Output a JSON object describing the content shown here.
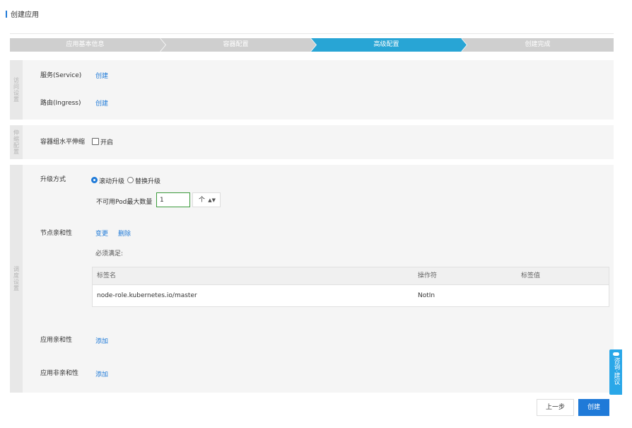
{
  "page": {
    "title": "创建应用"
  },
  "steps": [
    {
      "label": "应用基本信息",
      "state": "done"
    },
    {
      "label": "容器配置",
      "state": "done"
    },
    {
      "label": "高级配置",
      "state": "active"
    },
    {
      "label": "创建完成",
      "state": "todo"
    }
  ],
  "colors": {
    "step_inactive": "#cfcfcf",
    "step_active": "#28a5d5",
    "accent": "#1f7ad8",
    "float": "#2aa7e8"
  },
  "access": {
    "side_label": "访问设置",
    "service_label": "服务(Service)",
    "service_action": "创建",
    "ingress_label": "路由(Ingress)",
    "ingress_action": "创建"
  },
  "scaling": {
    "side_label": "伸缩配置",
    "hpa_label": "容器组水平伸缩",
    "enable_label": "开启",
    "enabled": false
  },
  "scheduling": {
    "side_label": "调度设置",
    "upgrade_label": "升级方式",
    "rolling_label": "滚动升级",
    "replace_label": "替换升级",
    "selected_mode": "滚动升级",
    "max_unavailable_label": "不可用Pod最大数量",
    "max_unavailable_value": "1",
    "unit_value": "个",
    "node_affinity_label": "节点亲和性",
    "change_action": "变更",
    "delete_action": "删除",
    "must_satisfy": "必须满足:",
    "table": {
      "headers": [
        "标签名",
        "操作符",
        "标签值"
      ],
      "rows": [
        [
          "node-role.kubernetes.io/master",
          "NotIn",
          ""
        ]
      ]
    },
    "app_affinity_label": "应用亲和性",
    "app_affinity_action": "添加",
    "app_anti_affinity_label": "应用非亲和性",
    "app_anti_affinity_action": "添加"
  },
  "footer": {
    "prev_label": "上一步",
    "create_label": "创建"
  },
  "float_widget": {
    "label": "咨询·建议"
  }
}
